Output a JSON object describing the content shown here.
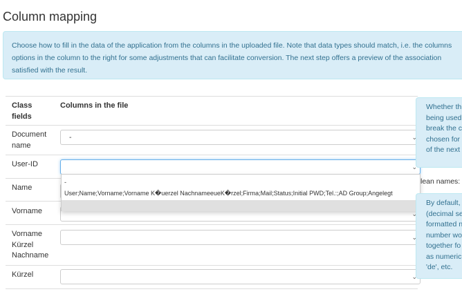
{
  "page": {
    "title": "Column mapping",
    "info_lines": [
      "Choose how to fill in the data of the application from the columns in the uploaded file. Note that data types should match, i.e. the columns",
      "options in the column to the right for some adjustments that can facilitate conversion. The next step offers a preview of the association",
      "satisfied with the result."
    ]
  },
  "table": {
    "header_class_fields_line1": "Class",
    "header_class_fields_line2": "fields",
    "header_columns": "Columns in the file",
    "rows": [
      {
        "label": [
          "Document",
          "name"
        ],
        "value": "-"
      },
      {
        "label": [
          "User-ID"
        ],
        "value": ""
      },
      {
        "label": [
          "Name"
        ],
        "value": ""
      },
      {
        "label": [
          "Vorname"
        ],
        "value": ""
      },
      {
        "label": [
          "Vorname",
          "Kürzel",
          "Nachname"
        ],
        "value": ""
      },
      {
        "label": [
          "Kürzel"
        ],
        "value": ""
      }
    ]
  },
  "dropdown": {
    "options": [
      "-",
      "User;Name;Vorname;Vorname K�uerzel NachnameeueK�rzel;Firma;Mail;Status;Initial PWD;Tel.:;AD Group;Angelegt",
      ""
    ]
  },
  "side_panel": {
    "box1_lines": [
      "Whether th",
      "being used",
      "break the c",
      "chosen for",
      "of the next"
    ],
    "label": "lean names:",
    "box2_lines": [
      "By default,",
      "(decimal se",
      "formatted n",
      "number wo",
      "together fo",
      "as numeric",
      "'de', etc."
    ]
  },
  "colors": {
    "info_bg": "#d9edf7",
    "info_text": "#31708f",
    "focus_border": "#66afe9"
  }
}
